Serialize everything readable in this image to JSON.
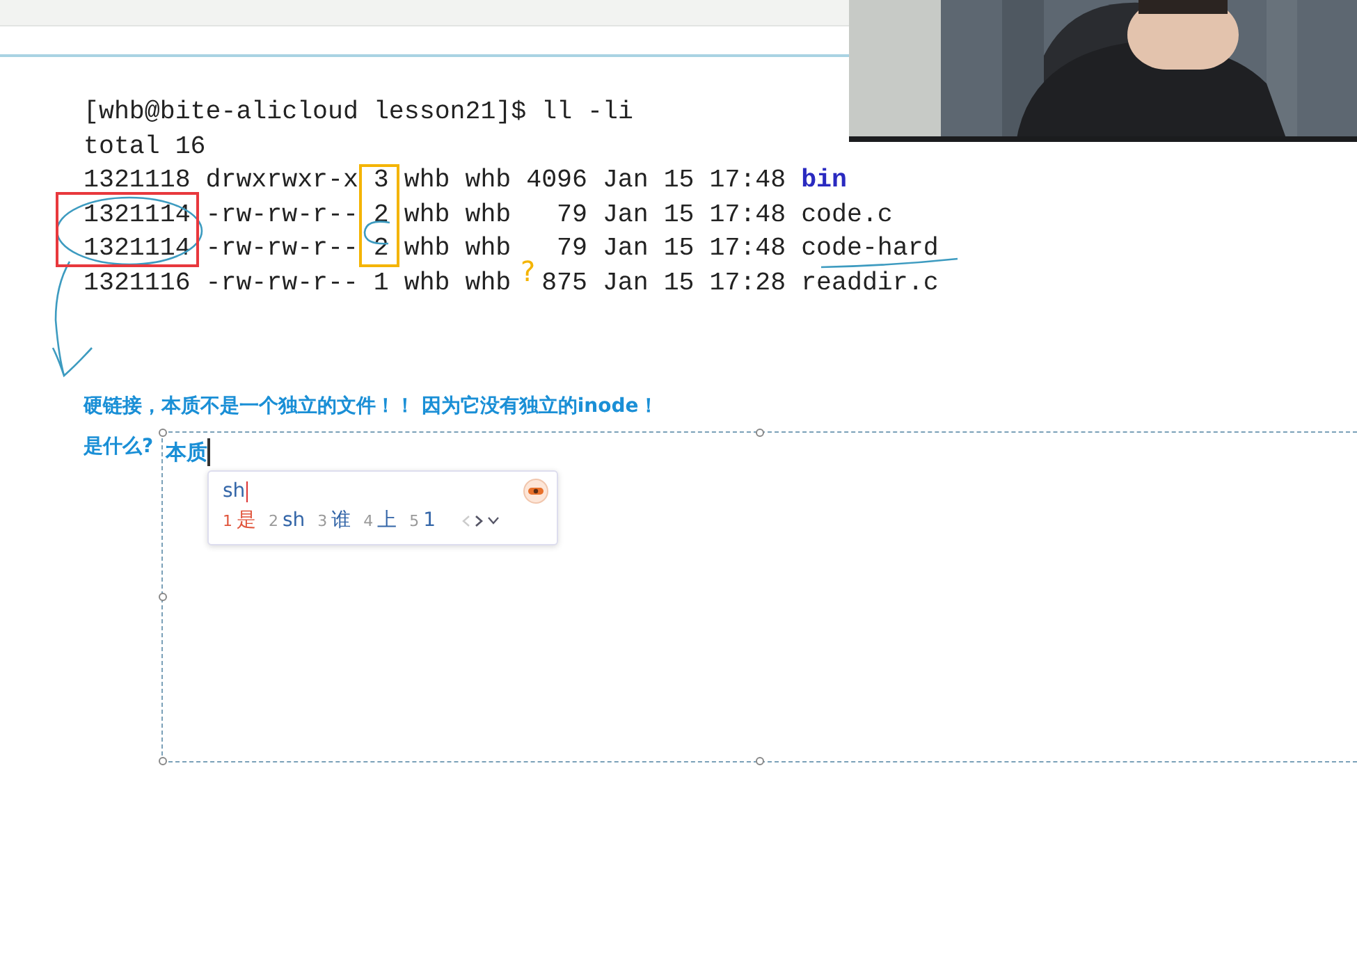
{
  "terminal": {
    "prompt": "[whb@bite-alicloud lesson21]$ ll -li",
    "total": "total 16",
    "rows": [
      {
        "inode": "1321118",
        "mode": "drwxrwxr-x",
        "links": "3",
        "owner": "whb",
        "group": "whb",
        "size": "4096",
        "date": "Jan 15 17:48",
        "name": "bin",
        "kind": "dir"
      },
      {
        "inode": "1321114",
        "mode": "-rw-rw-r--",
        "links": "2",
        "owner": "whb",
        "group": "whb",
        "size": "79",
        "date": "Jan 15 17:48",
        "name": "code.c",
        "kind": "file"
      },
      {
        "inode": "1321114",
        "mode": "-rw-rw-r--",
        "links": "2",
        "owner": "whb",
        "group": "whb",
        "size": "79",
        "date": "Jan 15 17:48",
        "name": "code-hard",
        "kind": "file"
      },
      {
        "inode": "1321116",
        "mode": "-rw-rw-r--",
        "links": "1",
        "owner": "whb",
        "group": "whb",
        "size": "875",
        "date": "Jan 15 17:28",
        "name": "readdir.c",
        "kind": "file"
      }
    ]
  },
  "ink_note": "?",
  "notes": {
    "line": "硬链接，本质不是一个独立的文件！！ 因为它没有独立的inode！",
    "question": "是什么?",
    "answer": "本质"
  },
  "ime": {
    "input": "sh",
    "candidates": [
      {
        "index": "1",
        "text": "是",
        "selected": true
      },
      {
        "index": "2",
        "text": "sh",
        "selected": false
      },
      {
        "index": "3",
        "text": "谁",
        "selected": false
      },
      {
        "index": "4",
        "text": "上",
        "selected": false
      },
      {
        "index": "5",
        "text": "1",
        "selected": false
      }
    ]
  }
}
